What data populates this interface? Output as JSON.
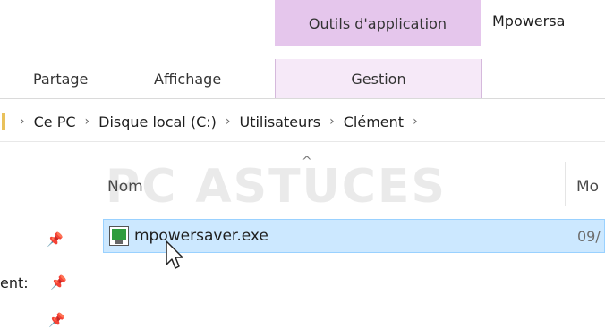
{
  "ribbon": {
    "context_tab_header": "Outils d'application",
    "window_title": "Mpowersa",
    "tabs": [
      "Partage",
      "Affichage",
      "Gestion"
    ]
  },
  "address": {
    "crumbs": [
      "Ce PC",
      "Disque local (C:)",
      "Utilisateurs",
      "Clément"
    ]
  },
  "columns": {
    "name": "Nom",
    "modified": "Mo"
  },
  "watermark": "PC ASTUCES",
  "file": {
    "name": "mpowersaver.exe",
    "date": "09/"
  },
  "nav": {
    "truncated_item": "ent:"
  }
}
